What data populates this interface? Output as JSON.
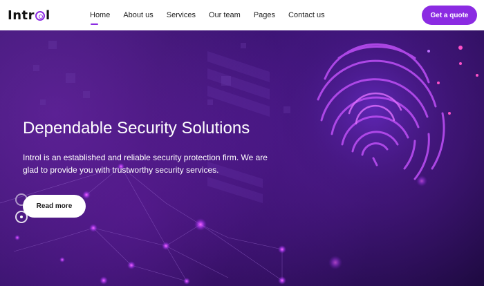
{
  "header": {
    "logo_left": "Intr",
    "logo_right": "l",
    "nav": [
      "Home",
      "About us",
      "Services",
      "Our team",
      "Pages",
      "Contact us"
    ],
    "active_nav": "Home",
    "quote_label": "Get a quote"
  },
  "hero": {
    "title": "Dependable Security Solutions",
    "description": "Introl is an established and reliable security protection firm. We are glad to provide you with trustworthy security services.",
    "read_more_label": "Read more"
  },
  "colors": {
    "accent": "#8b2be2",
    "hero_bg": "#2a0e5c",
    "header_bg": "#ffffff"
  }
}
